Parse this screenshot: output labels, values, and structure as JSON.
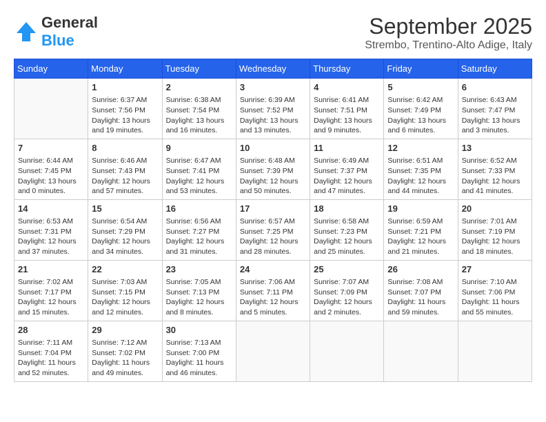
{
  "header": {
    "logo_general": "General",
    "logo_blue": "Blue",
    "month": "September 2025",
    "location": "Strembo, Trentino-Alto Adige, Italy"
  },
  "days_of_week": [
    "Sunday",
    "Monday",
    "Tuesday",
    "Wednesday",
    "Thursday",
    "Friday",
    "Saturday"
  ],
  "weeks": [
    [
      {
        "day": "",
        "info": ""
      },
      {
        "day": "1",
        "info": "Sunrise: 6:37 AM\nSunset: 7:56 PM\nDaylight: 13 hours\nand 19 minutes."
      },
      {
        "day": "2",
        "info": "Sunrise: 6:38 AM\nSunset: 7:54 PM\nDaylight: 13 hours\nand 16 minutes."
      },
      {
        "day": "3",
        "info": "Sunrise: 6:39 AM\nSunset: 7:52 PM\nDaylight: 13 hours\nand 13 minutes."
      },
      {
        "day": "4",
        "info": "Sunrise: 6:41 AM\nSunset: 7:51 PM\nDaylight: 13 hours\nand 9 minutes."
      },
      {
        "day": "5",
        "info": "Sunrise: 6:42 AM\nSunset: 7:49 PM\nDaylight: 13 hours\nand 6 minutes."
      },
      {
        "day": "6",
        "info": "Sunrise: 6:43 AM\nSunset: 7:47 PM\nDaylight: 13 hours\nand 3 minutes."
      }
    ],
    [
      {
        "day": "7",
        "info": "Sunrise: 6:44 AM\nSunset: 7:45 PM\nDaylight: 13 hours\nand 0 minutes."
      },
      {
        "day": "8",
        "info": "Sunrise: 6:46 AM\nSunset: 7:43 PM\nDaylight: 12 hours\nand 57 minutes."
      },
      {
        "day": "9",
        "info": "Sunrise: 6:47 AM\nSunset: 7:41 PM\nDaylight: 12 hours\nand 53 minutes."
      },
      {
        "day": "10",
        "info": "Sunrise: 6:48 AM\nSunset: 7:39 PM\nDaylight: 12 hours\nand 50 minutes."
      },
      {
        "day": "11",
        "info": "Sunrise: 6:49 AM\nSunset: 7:37 PM\nDaylight: 12 hours\nand 47 minutes."
      },
      {
        "day": "12",
        "info": "Sunrise: 6:51 AM\nSunset: 7:35 PM\nDaylight: 12 hours\nand 44 minutes."
      },
      {
        "day": "13",
        "info": "Sunrise: 6:52 AM\nSunset: 7:33 PM\nDaylight: 12 hours\nand 41 minutes."
      }
    ],
    [
      {
        "day": "14",
        "info": "Sunrise: 6:53 AM\nSunset: 7:31 PM\nDaylight: 12 hours\nand 37 minutes."
      },
      {
        "day": "15",
        "info": "Sunrise: 6:54 AM\nSunset: 7:29 PM\nDaylight: 12 hours\nand 34 minutes."
      },
      {
        "day": "16",
        "info": "Sunrise: 6:56 AM\nSunset: 7:27 PM\nDaylight: 12 hours\nand 31 minutes."
      },
      {
        "day": "17",
        "info": "Sunrise: 6:57 AM\nSunset: 7:25 PM\nDaylight: 12 hours\nand 28 minutes."
      },
      {
        "day": "18",
        "info": "Sunrise: 6:58 AM\nSunset: 7:23 PM\nDaylight: 12 hours\nand 25 minutes."
      },
      {
        "day": "19",
        "info": "Sunrise: 6:59 AM\nSunset: 7:21 PM\nDaylight: 12 hours\nand 21 minutes."
      },
      {
        "day": "20",
        "info": "Sunrise: 7:01 AM\nSunset: 7:19 PM\nDaylight: 12 hours\nand 18 minutes."
      }
    ],
    [
      {
        "day": "21",
        "info": "Sunrise: 7:02 AM\nSunset: 7:17 PM\nDaylight: 12 hours\nand 15 minutes."
      },
      {
        "day": "22",
        "info": "Sunrise: 7:03 AM\nSunset: 7:15 PM\nDaylight: 12 hours\nand 12 minutes."
      },
      {
        "day": "23",
        "info": "Sunrise: 7:05 AM\nSunset: 7:13 PM\nDaylight: 12 hours\nand 8 minutes."
      },
      {
        "day": "24",
        "info": "Sunrise: 7:06 AM\nSunset: 7:11 PM\nDaylight: 12 hours\nand 5 minutes."
      },
      {
        "day": "25",
        "info": "Sunrise: 7:07 AM\nSunset: 7:09 PM\nDaylight: 12 hours\nand 2 minutes."
      },
      {
        "day": "26",
        "info": "Sunrise: 7:08 AM\nSunset: 7:07 PM\nDaylight: 11 hours\nand 59 minutes."
      },
      {
        "day": "27",
        "info": "Sunrise: 7:10 AM\nSunset: 7:06 PM\nDaylight: 11 hours\nand 55 minutes."
      }
    ],
    [
      {
        "day": "28",
        "info": "Sunrise: 7:11 AM\nSunset: 7:04 PM\nDaylight: 11 hours\nand 52 minutes."
      },
      {
        "day": "29",
        "info": "Sunrise: 7:12 AM\nSunset: 7:02 PM\nDaylight: 11 hours\nand 49 minutes."
      },
      {
        "day": "30",
        "info": "Sunrise: 7:13 AM\nSunset: 7:00 PM\nDaylight: 11 hours\nand 46 minutes."
      },
      {
        "day": "",
        "info": ""
      },
      {
        "day": "",
        "info": ""
      },
      {
        "day": "",
        "info": ""
      },
      {
        "day": "",
        "info": ""
      }
    ]
  ]
}
